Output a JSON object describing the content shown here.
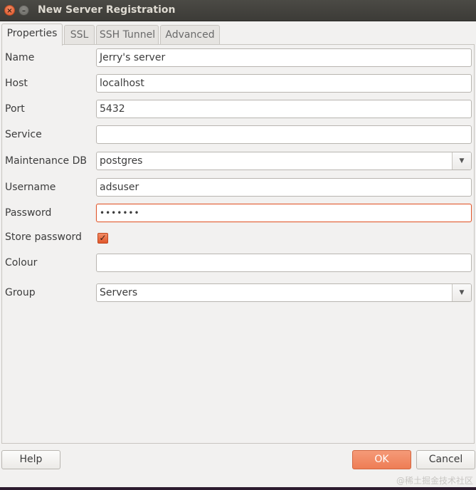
{
  "window": {
    "title": "New Server Registration",
    "close_glyph": "×",
    "minimize_glyph": "–"
  },
  "tabs": [
    {
      "label": "Properties"
    },
    {
      "label": "SSL"
    },
    {
      "label": "SSH Tunnel"
    },
    {
      "label": "Advanced"
    }
  ],
  "form": {
    "name": {
      "label": "Name",
      "value": "Jerry's server"
    },
    "host": {
      "label": "Host",
      "value": "localhost"
    },
    "port": {
      "label": "Port",
      "value": "5432"
    },
    "service": {
      "label": "Service",
      "value": ""
    },
    "maintenance_db": {
      "label": "Maintenance DB",
      "value": "postgres"
    },
    "username": {
      "label": "Username",
      "value": "adsuser"
    },
    "password": {
      "label": "Password",
      "value": "•••••••"
    },
    "store_password": {
      "label": "Store password",
      "checked": true,
      "glyph": "✓"
    },
    "colour": {
      "label": "Colour",
      "value": ""
    },
    "group": {
      "label": "Group",
      "value": "Servers"
    }
  },
  "dropdown_glyph": "▼",
  "buttons": {
    "help": "Help",
    "ok": "OK",
    "cancel": "Cancel"
  },
  "watermark": "@稀土掘金技术社区",
  "colors": {
    "accent": "#e0572c",
    "titlebar": "#3c3b37"
  }
}
